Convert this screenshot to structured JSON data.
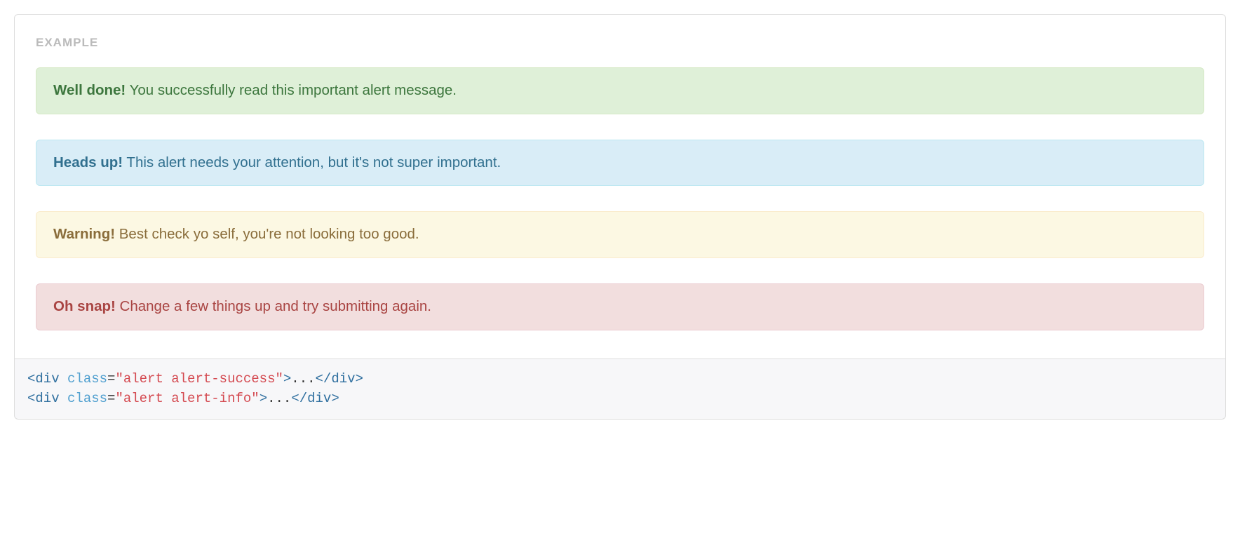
{
  "example_label": "EXAMPLE",
  "alerts": [
    {
      "type": "success",
      "strong": "Well done!",
      "text": " You successfully read this important alert message."
    },
    {
      "type": "info",
      "strong": "Heads up!",
      "text": " This alert needs your attention, but it's not super important."
    },
    {
      "type": "warning",
      "strong": "Warning!",
      "text": " Best check yo self, you're not looking too good."
    },
    {
      "type": "danger",
      "strong": "Oh snap!",
      "text": " Change a few things up and try submitting again."
    }
  ],
  "code": {
    "lines": [
      {
        "class_value": "alert alert-success"
      },
      {
        "class_value": "alert alert-info"
      }
    ],
    "tag_open": "<div",
    "attr_name": " class",
    "eq": "=",
    "q": "\"",
    "close_open": ">",
    "ellipsis": "...",
    "tag_close": "</div>"
  }
}
